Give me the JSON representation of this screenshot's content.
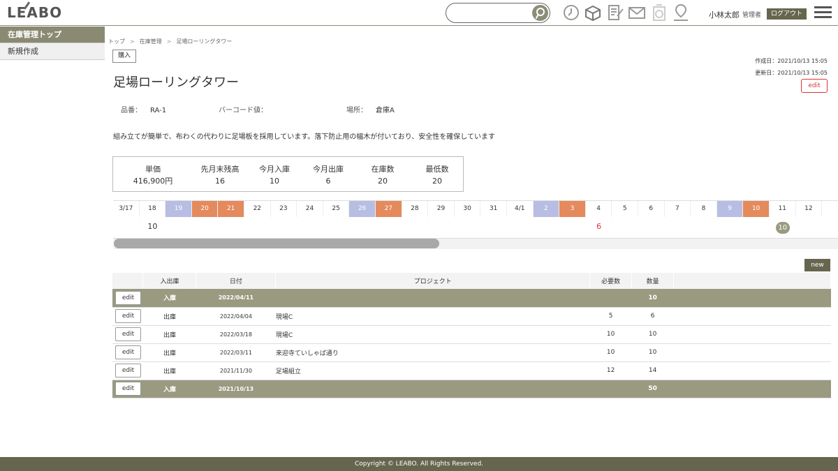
{
  "header": {
    "logo": "LEABO",
    "search": {
      "placeholder": ""
    },
    "icons": [
      "clock-icon",
      "box-icon",
      "note-icon",
      "mail-icon",
      "timer-icon",
      "map-pin-icon"
    ],
    "user_name": "小林太郎",
    "user_role": "管理者",
    "logout_label": "ログアウト"
  },
  "sidebar": {
    "items": [
      {
        "label": "在庫管理トップ",
        "active": true
      },
      {
        "label": "新規作成",
        "active": false
      }
    ]
  },
  "breadcrumb": [
    "トップ",
    "在庫管理",
    "足場ローリングタワー"
  ],
  "tag": "購入",
  "created": "作成日：2021/10/13 15:05",
  "updated": "更新日：2021/10/13 15:05",
  "edit_label": "edit",
  "title": "足場ローリングタワー",
  "meta": {
    "part_no_label": "品番：",
    "part_no": "RA-1",
    "barcode_label": "バーコード値：",
    "barcode": "",
    "location_label": "場所：",
    "location": "倉庫A"
  },
  "description": "組み立てが簡単で、布わくの代わりに足場板を採用しています。落下防止用の幅木が付いており、安全性を確保しています",
  "summary": [
    {
      "label": "単価",
      "value": "416,900円"
    },
    {
      "label": "先月末残高",
      "value": "16"
    },
    {
      "label": "今月入庫",
      "value": "10"
    },
    {
      "label": "今月出庫",
      "value": "6"
    },
    {
      "label": "在庫数",
      "value": "20"
    },
    {
      "label": "最低数",
      "value": "20"
    }
  ],
  "calendar": {
    "days": [
      {
        "d": "3/17",
        "type": ""
      },
      {
        "d": "18",
        "type": ""
      },
      {
        "d": "19",
        "type": "blue"
      },
      {
        "d": "20",
        "type": "orange"
      },
      {
        "d": "21",
        "type": "orange"
      },
      {
        "d": "22",
        "type": ""
      },
      {
        "d": "23",
        "type": ""
      },
      {
        "d": "24",
        "type": ""
      },
      {
        "d": "25",
        "type": ""
      },
      {
        "d": "26",
        "type": "blue"
      },
      {
        "d": "27",
        "type": "orange"
      },
      {
        "d": "28",
        "type": ""
      },
      {
        "d": "29",
        "type": ""
      },
      {
        "d": "30",
        "type": ""
      },
      {
        "d": "31",
        "type": ""
      },
      {
        "d": "4/1",
        "type": ""
      },
      {
        "d": "2",
        "type": "blue"
      },
      {
        "d": "3",
        "type": "orange"
      },
      {
        "d": "4",
        "type": ""
      },
      {
        "d": "5",
        "type": ""
      },
      {
        "d": "6",
        "type": ""
      },
      {
        "d": "7",
        "type": ""
      },
      {
        "d": "8",
        "type": ""
      },
      {
        "d": "9",
        "type": "blue"
      },
      {
        "d": "10",
        "type": "orange"
      },
      {
        "d": "11",
        "type": ""
      },
      {
        "d": "12",
        "type": ""
      }
    ],
    "values": [
      {
        "day_index": 1,
        "value": "10",
        "style": "plain"
      },
      {
        "day_index": 18,
        "value": "6",
        "style": "red"
      },
      {
        "day_index": 25,
        "value": "10",
        "style": "pill"
      }
    ],
    "scroll_fraction": 0.45
  },
  "new_label": "new",
  "table": {
    "headers": [
      "",
      "入出庫",
      "日付",
      "プロジェクト",
      "必要数",
      "数量",
      ""
    ],
    "rows": [
      {
        "kind": "in",
        "type": "入庫",
        "date": "2022/04/11",
        "project": "",
        "need": "",
        "qty": "10",
        "qty_red": false
      },
      {
        "kind": "out",
        "type": "出庫",
        "date": "2022/04/04",
        "project": "現場C",
        "need": "5",
        "qty": "6",
        "qty_red": true
      },
      {
        "kind": "out",
        "type": "出庫",
        "date": "2022/03/18",
        "project": "現場C",
        "need": "10",
        "qty": "10",
        "qty_red": false
      },
      {
        "kind": "out",
        "type": "出庫",
        "date": "2022/03/11",
        "project": "来迎寺ていしゃば通り",
        "need": "10",
        "qty": "10",
        "qty_red": false
      },
      {
        "kind": "out",
        "type": "出庫",
        "date": "2021/11/30",
        "project": "足場組立",
        "need": "12",
        "qty": "14",
        "qty_red": true
      },
      {
        "kind": "in",
        "type": "入庫",
        "date": "2021/10/13",
        "project": "",
        "need": "",
        "qty": "50",
        "qty_red": false
      }
    ]
  },
  "footer": "Copyright © LEABO. All Rights Reserved."
}
